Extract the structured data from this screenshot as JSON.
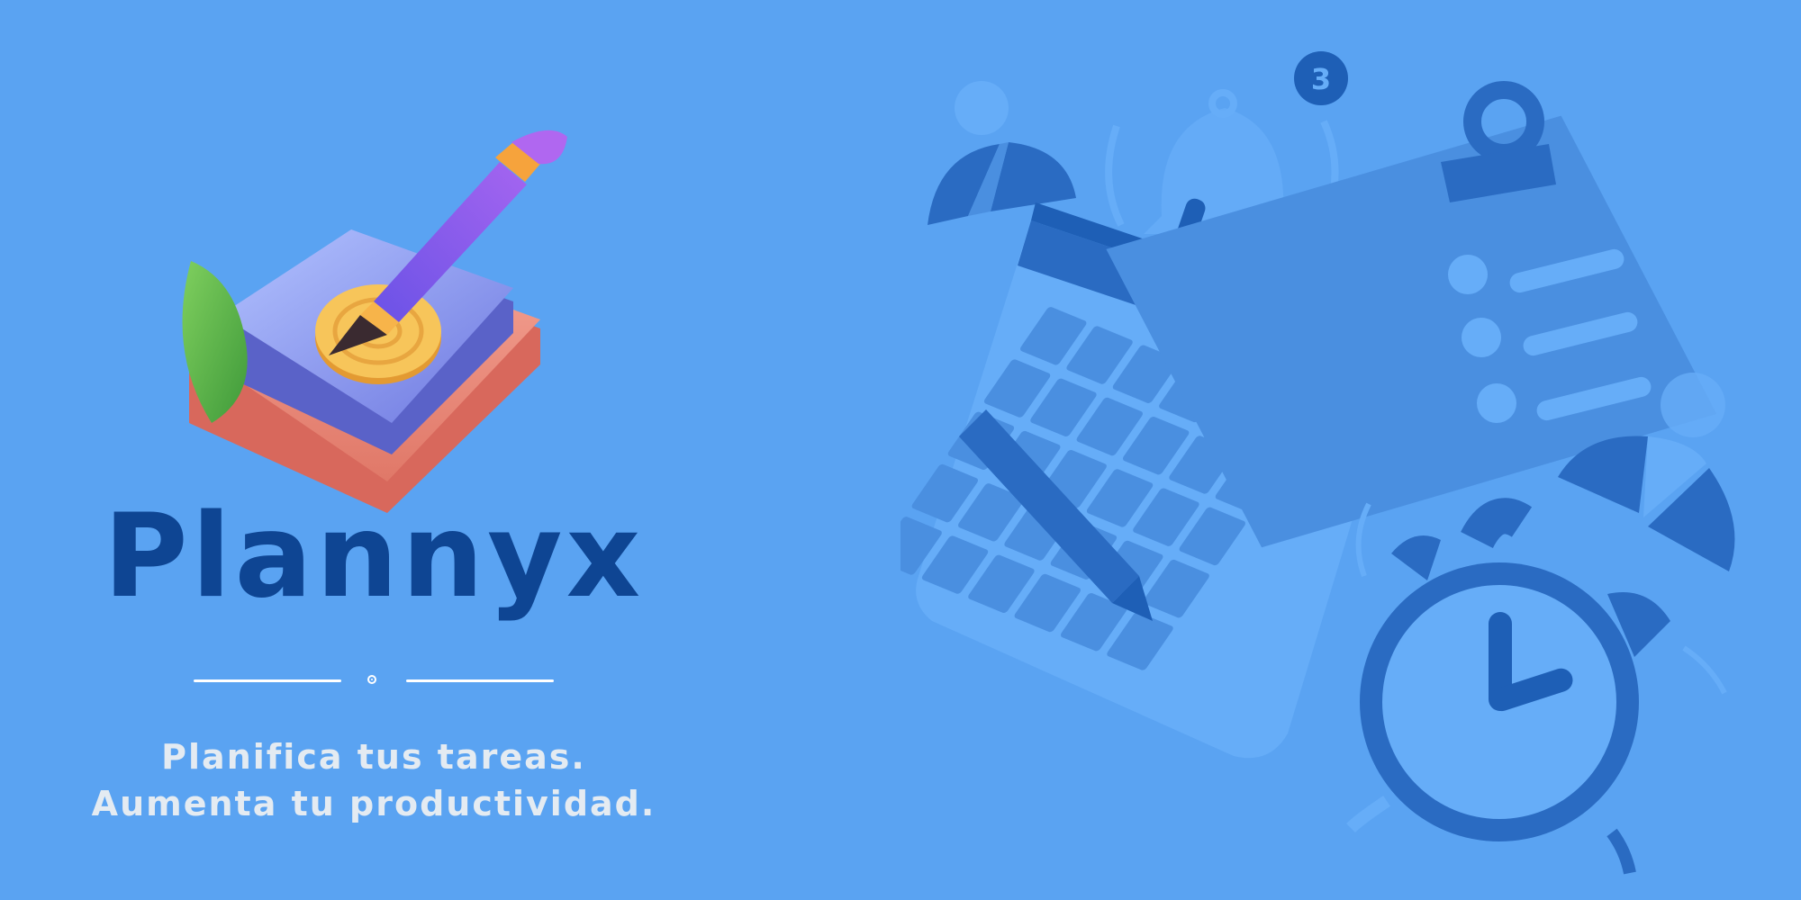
{
  "app": {
    "title": "Plannyx",
    "tagline_line1": "Planifica tus tareas.",
    "tagline_line2": "Aumenta tu productividad."
  },
  "illustration": {
    "notification_badge": "3"
  },
  "colors": {
    "background": "#5aa3f2",
    "title": "#0e4593",
    "tagline": "#e4ebf2",
    "illustration_dark": "#2a6bc2",
    "illustration_mid": "#4a8fe0",
    "illustration_light": "#66adf8"
  },
  "icons": [
    "plannyx-logo-icon",
    "leaf-icon",
    "coin-icon",
    "pencil-icon",
    "calendar-icon",
    "clipboard-icon",
    "bell-icon",
    "alarm-clock-icon",
    "pie-chart-icon",
    "person-icon"
  ]
}
